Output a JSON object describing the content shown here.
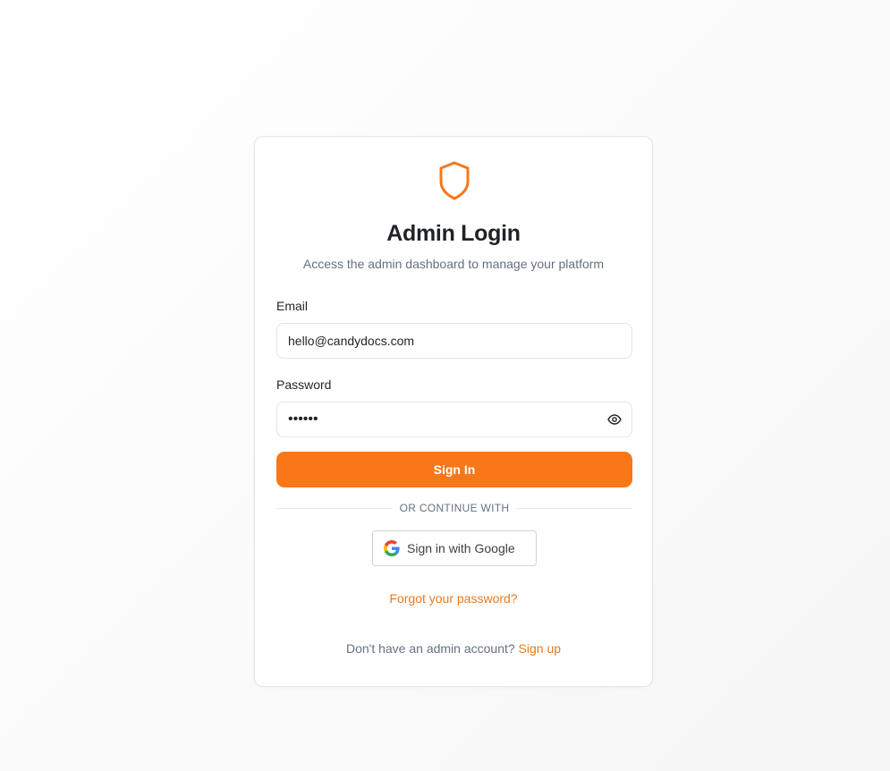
{
  "brand": {
    "accent_color": "#f97718",
    "logo_icon": "shield-icon"
  },
  "header": {
    "title": "Admin Login",
    "subtitle": "Access the admin dashboard to manage your platform"
  },
  "form": {
    "email_label": "Email",
    "email_value": "hello@candydocs.com",
    "password_label": "Password",
    "password_mask": "••••••",
    "password_toggle_icon": "eye-icon",
    "submit_label": "Sign In"
  },
  "divider": {
    "text": "OR CONTINUE WITH"
  },
  "google": {
    "icon": "google-icon",
    "label": "Sign in with Google"
  },
  "links": {
    "forgot_password": "Forgot your password?",
    "no_account_text": "Don't have an admin account?",
    "signup_label": "Sign up"
  }
}
